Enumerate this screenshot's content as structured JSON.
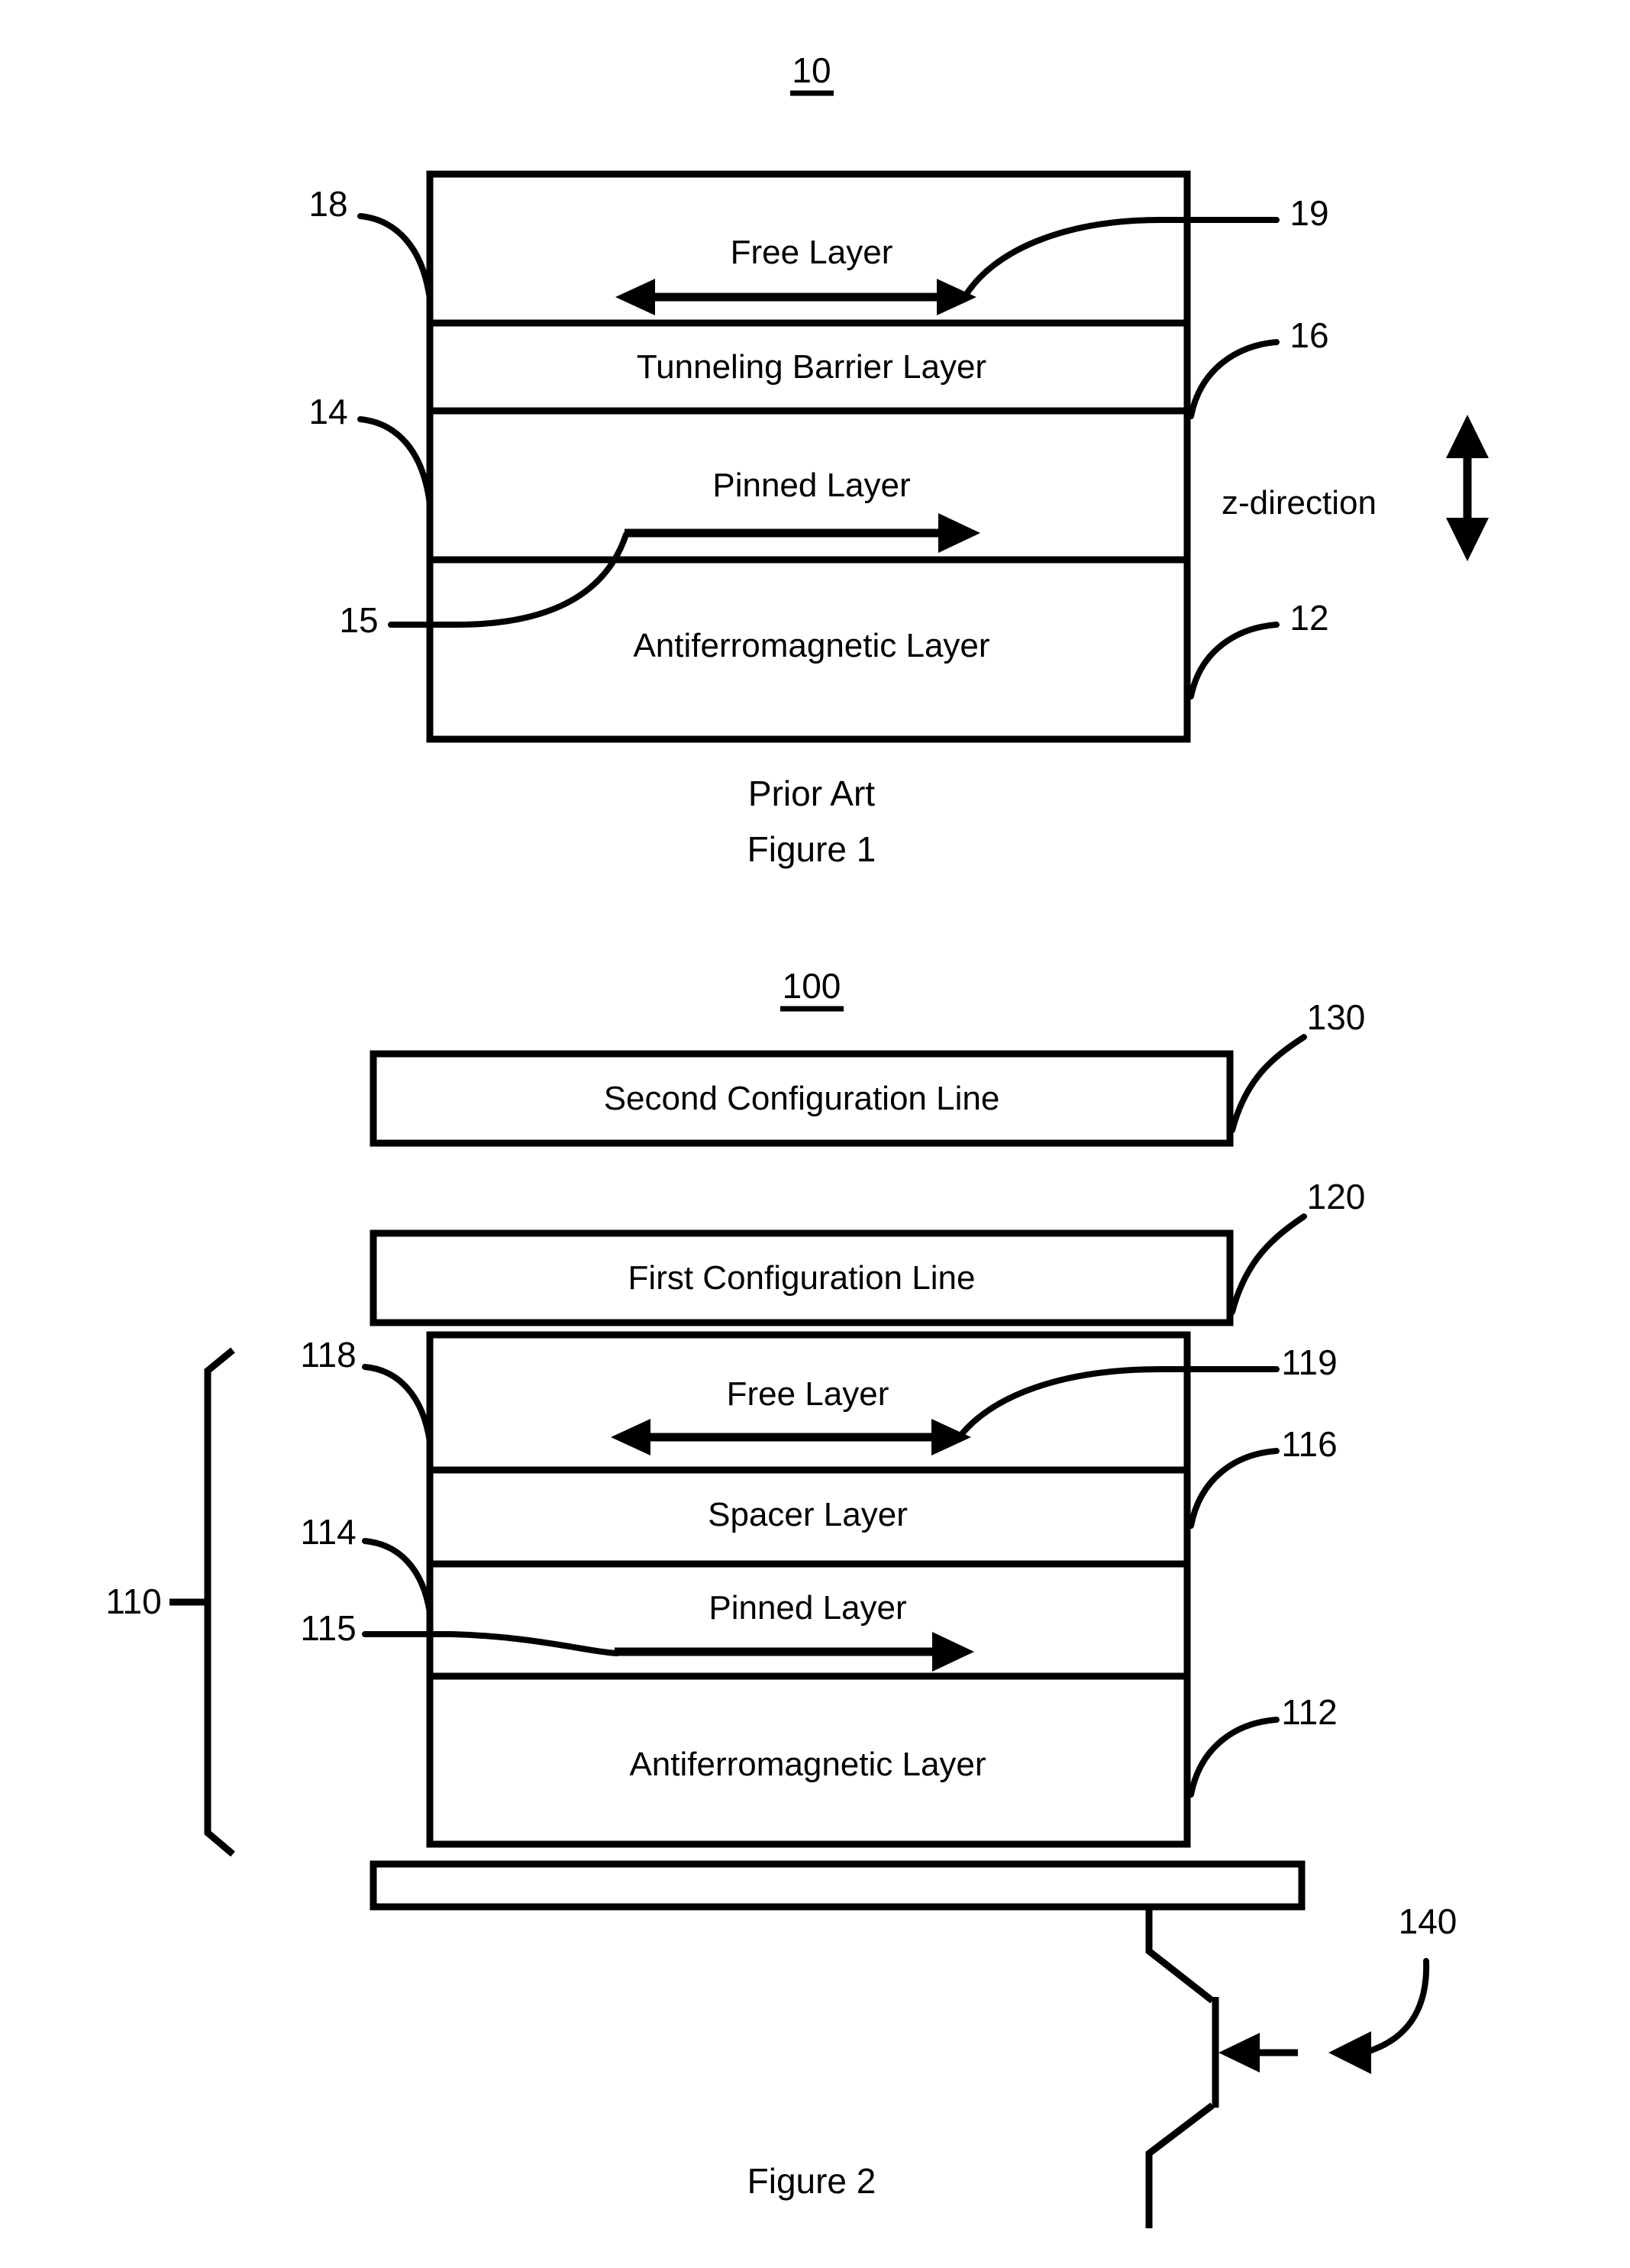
{
  "sheet": {
    "background_color": "#ffffff",
    "ink_color": "#000000"
  },
  "figure1": {
    "figure_number": "10",
    "caption_line1": "Prior Art",
    "caption_line2": "Figure 1",
    "axis_label": "z-direction",
    "layers": [
      {
        "ref": "18",
        "label": "Free Layer",
        "magnetization": "bidirectional"
      },
      {
        "ref": "16",
        "label": "Tunneling Barrier Layer",
        "magnetization": "none"
      },
      {
        "ref": "14",
        "label": "Pinned Layer",
        "magnetization": "right"
      },
      {
        "ref": "12",
        "label": "Antiferromagnetic Layer",
        "magnetization": "none"
      }
    ],
    "arrow_refs": [
      {
        "ref": "19",
        "points_to": "free-layer-arrow"
      },
      {
        "ref": "15",
        "points_to": "pinned-layer-arrow"
      }
    ]
  },
  "figure2": {
    "figure_number": "100",
    "caption_line1": "Figure 2",
    "stack_ref": "110",
    "lines": [
      {
        "ref": "130",
        "label": "Second Configuration Line"
      },
      {
        "ref": "120",
        "label": "First Configuration Line"
      }
    ],
    "layers": [
      {
        "ref": "118",
        "label": "Free Layer",
        "magnetization": "bidirectional"
      },
      {
        "ref": "116",
        "label": "Spacer Layer",
        "magnetization": "none"
      },
      {
        "ref": "114",
        "label": "Pinned Layer",
        "magnetization": "right"
      },
      {
        "ref": "112",
        "label": "Antiferromagnetic Layer",
        "magnetization": "none"
      }
    ],
    "arrow_refs": [
      {
        "ref": "119",
        "points_to": "free-layer-arrow"
      },
      {
        "ref": "115",
        "points_to": "pinned-layer-arrow"
      }
    ],
    "transistor": {
      "ref": "140",
      "type": "npn-bipolar-transistor"
    }
  }
}
